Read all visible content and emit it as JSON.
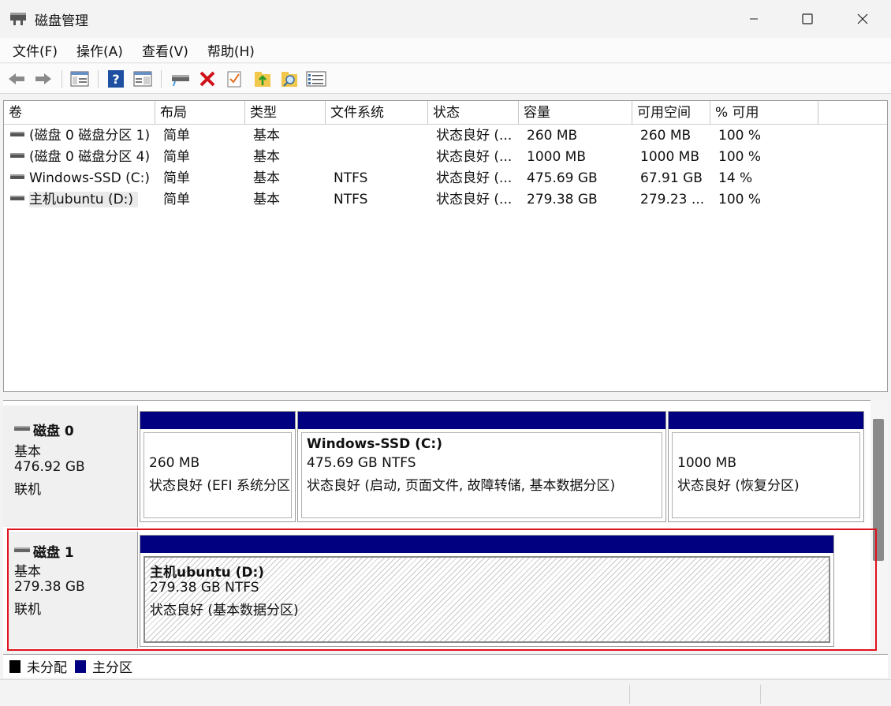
{
  "window": {
    "title": "磁盘管理"
  },
  "menu": [
    "文件(F)",
    "操作(A)",
    "查看(V)",
    "帮助(H)"
  ],
  "toolbar": [
    "back-icon",
    "forward-icon",
    "show-hide-console-tree-icon",
    "help-icon",
    "properties-icon",
    "connect-drive-icon",
    "delete-icon",
    "checklist-icon",
    "folder-up-icon",
    "folder-search-icon",
    "settings-list-icon"
  ],
  "volumes": {
    "columns": [
      "卷",
      "布局",
      "类型",
      "文件系统",
      "状态",
      "容量",
      "可用空间",
      "% 可用"
    ],
    "rows": [
      {
        "name": "(磁盘 0 磁盘分区 1)",
        "layout": "简单",
        "type": "基本",
        "fs": "",
        "status": "状态良好 (...",
        "capacity": "260 MB",
        "free": "260 MB",
        "pct": "100 %"
      },
      {
        "name": "(磁盘 0 磁盘分区 4)",
        "layout": "简单",
        "type": "基本",
        "fs": "",
        "status": "状态良好 (...",
        "capacity": "1000 MB",
        "free": "1000 MB",
        "pct": "100 %"
      },
      {
        "name": "Windows-SSD (C:)",
        "layout": "简单",
        "type": "基本",
        "fs": "NTFS",
        "status": "状态良好 (...",
        "capacity": "475.69 GB",
        "free": "67.91 GB",
        "pct": "14 %"
      },
      {
        "name": "主机ubuntu (D:)",
        "layout": "简单",
        "type": "基本",
        "fs": "NTFS",
        "status": "状态良好 (...",
        "capacity": "279.38 GB",
        "free": "279.23 ...",
        "pct": "100 %"
      }
    ]
  },
  "disks": [
    {
      "name": "磁盘 0",
      "type": "基本",
      "size": "476.92 GB",
      "state": "联机",
      "partitions": [
        {
          "name": "",
          "line1": "260 MB",
          "line2": "状态良好 (EFI 系统分区)"
        },
        {
          "name": "Windows-SSD  (C:)",
          "line1": "475.69 GB NTFS",
          "line2": "状态良好 (启动, 页面文件, 故障转储, 基本数据分区)"
        },
        {
          "name": "",
          "line1": "1000 MB",
          "line2": "状态良好 (恢复分区)"
        }
      ]
    },
    {
      "name": "磁盘 1",
      "type": "基本",
      "size": "279.38 GB",
      "state": "联机",
      "partitions": [
        {
          "name": "主机ubuntu  (D:)",
          "line1": "279.38 GB NTFS",
          "line2": "状态良好 (基本数据分区)"
        }
      ]
    }
  ],
  "legend": [
    {
      "label": "未分配",
      "color": "#000000"
    },
    {
      "label": "主分区",
      "color": "#000080"
    }
  ]
}
